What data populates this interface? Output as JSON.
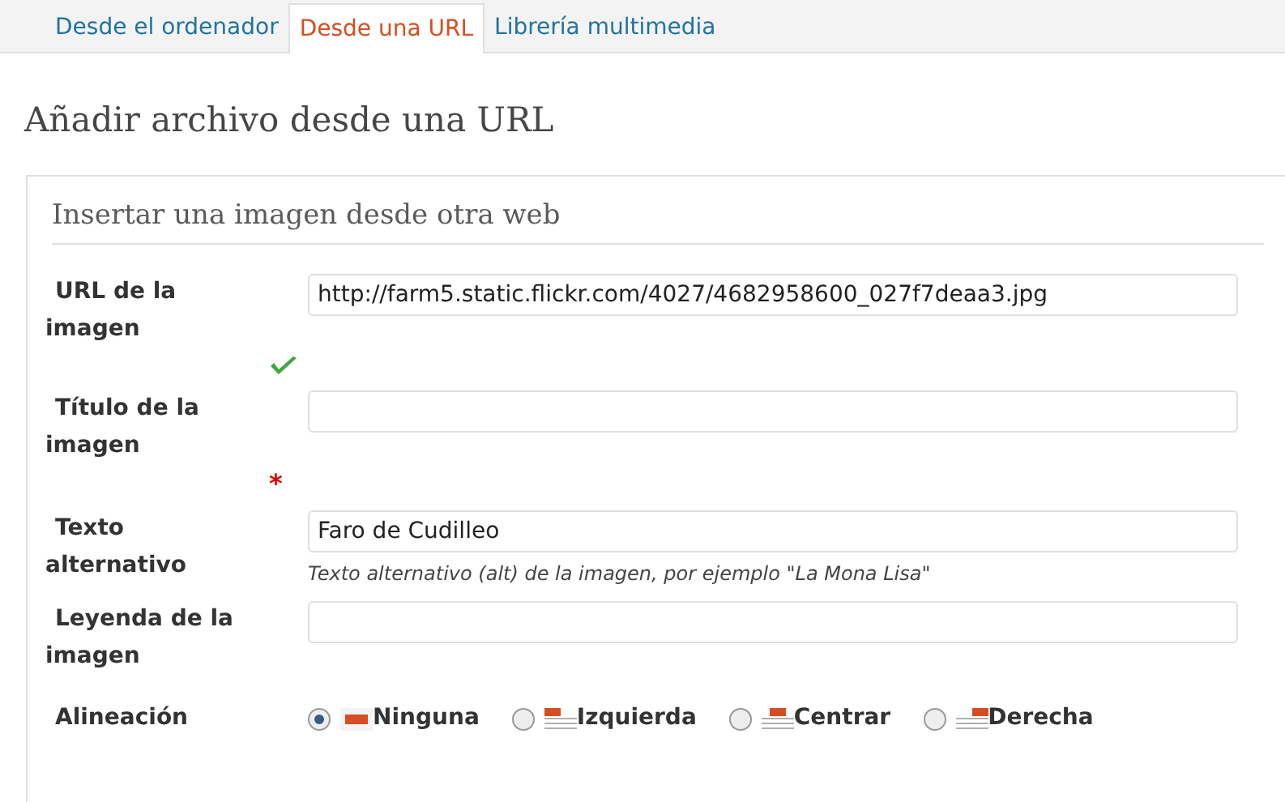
{
  "tabs": [
    {
      "label": "Desde el ordenador",
      "selected": false
    },
    {
      "label": "Desde una URL",
      "selected": true
    },
    {
      "label": "Librería multimedia",
      "selected": false
    }
  ],
  "heading": "Añadir archivo desde una URL",
  "section": {
    "title": "Insertar una imagen desde otra web",
    "fields": [
      {
        "label": "URL de la imagen",
        "value": "http://farm5.static.flickr.com/4027/4682958600_027f7deaa3.jpg",
        "valid": true
      },
      {
        "label": "Título de la imagen",
        "required_mark": "*"
      },
      {
        "label": "Texto alternativo",
        "value": "Faro de Cudilleo",
        "hint": "Texto alternativo (alt) de la imagen, por ejemplo \"La Mona Lisa\""
      },
      {
        "label": "Leyenda de la imagen"
      }
    ],
    "alignment": {
      "label": "Alineación",
      "options": [
        {
          "label": "Ninguna",
          "kind": "none",
          "selected": true
        },
        {
          "label": "Izquierda",
          "kind": "left",
          "selected": false
        },
        {
          "label": "Centrar",
          "kind": "center",
          "selected": false
        },
        {
          "label": "Derecha",
          "kind": "right",
          "selected": false
        }
      ]
    }
  }
}
